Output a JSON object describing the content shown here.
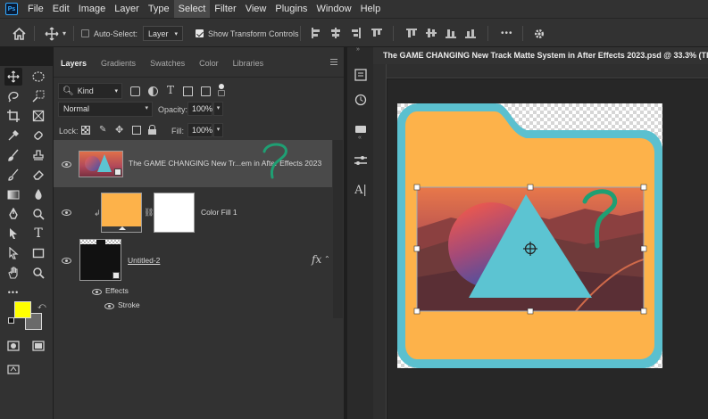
{
  "app": {
    "logo": "Ps"
  },
  "menu": [
    "File",
    "Edit",
    "Image",
    "Layer",
    "Type",
    "Select",
    "Filter",
    "View",
    "Plugins",
    "Window",
    "Help"
  ],
  "options": {
    "auto_select_label": "Auto-Select:",
    "auto_select_target": "Layer",
    "show_transform_label": "Show Transform Controls",
    "more_label": "•••"
  },
  "panels": {
    "tabs": [
      "Layers",
      "Gradients",
      "Swatches",
      "Color",
      "Libraries"
    ],
    "filter_kind": "Kind",
    "blend_mode": "Normal",
    "opacity_label": "Opacity:",
    "opacity_value": "100%",
    "lock_label": "Lock:",
    "fill_label": "Fill:",
    "fill_value": "100%"
  },
  "layers": [
    {
      "name": "The GAME CHANGING New Tr...em in After Effects 2023"
    },
    {
      "name": "Color Fill 1"
    },
    {
      "name": "Untitled-2",
      "fx": "fx",
      "effects_label": "Effects",
      "stroke_label": "Stroke"
    }
  ],
  "document": {
    "title": "The GAME CHANGING New Track Matte System in After Effects 2023.psd @ 33.3% (TI"
  },
  "colors": {
    "foreground": "#ffff00",
    "background": "#6a6a6a",
    "folder_orange": "#fdb24a",
    "folder_teal": "#5bc0cf",
    "question_green": "#1f9f73"
  },
  "icons": {
    "home": "home-icon",
    "move": "move-icon",
    "settings": "gear-icon"
  }
}
